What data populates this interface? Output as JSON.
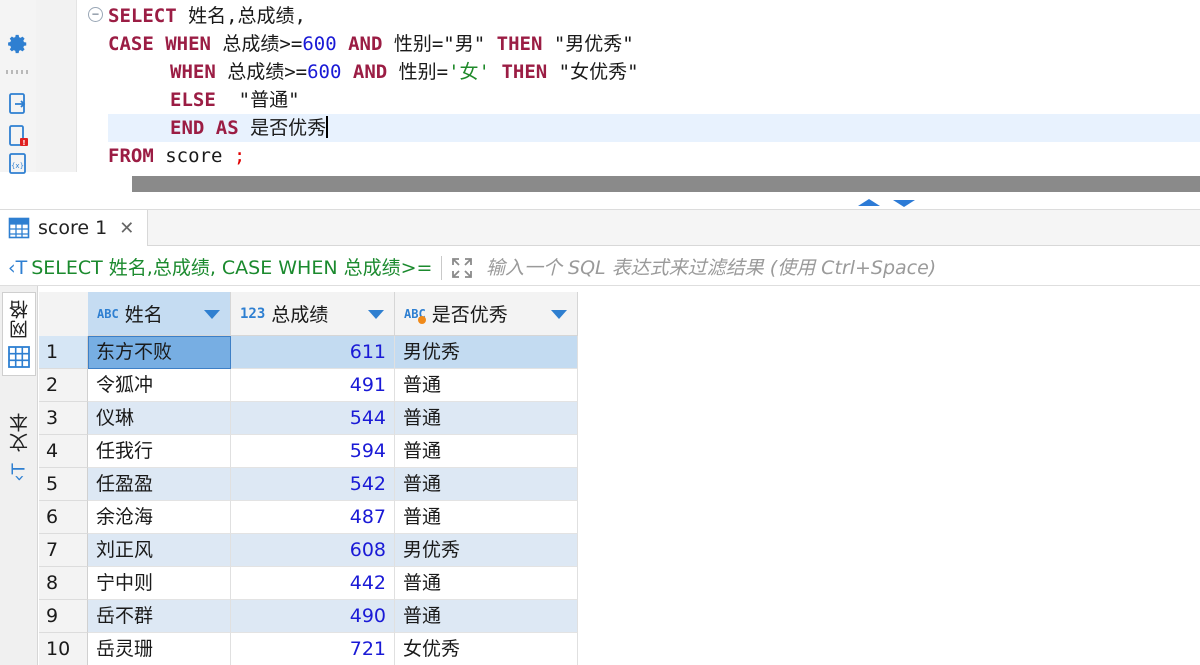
{
  "editor": {
    "lines": [
      {
        "parts": [
          [
            "kw",
            "SELECT"
          ],
          [
            "txt",
            " 姓名,总成绩,"
          ]
        ]
      },
      {
        "parts": [
          [
            "kw",
            "CASE"
          ],
          [
            "txt",
            " "
          ],
          [
            "kw",
            "WHEN"
          ],
          [
            "txt",
            " 总成绩>="
          ],
          [
            "num",
            "600"
          ],
          [
            "txt",
            " "
          ],
          [
            "kw",
            "AND"
          ],
          [
            "txt",
            " 性别=\"男\" "
          ],
          [
            "kw",
            "THEN"
          ],
          [
            "txt",
            " \"男优秀\""
          ]
        ]
      },
      {
        "indent": true,
        "parts": [
          [
            "kw",
            "WHEN"
          ],
          [
            "txt",
            " 总成绩>="
          ],
          [
            "num",
            "600"
          ],
          [
            "txt",
            " "
          ],
          [
            "kw",
            "AND"
          ],
          [
            "txt",
            " 性别="
          ],
          [
            "str-g",
            "'女'"
          ],
          [
            "txt",
            " "
          ],
          [
            "kw",
            "THEN"
          ],
          [
            "txt",
            " \"女优秀\""
          ]
        ]
      },
      {
        "indent": true,
        "parts": [
          [
            "kw",
            "ELSE"
          ],
          [
            "txt",
            "  \"普通\""
          ]
        ]
      },
      {
        "indent": true,
        "current": true,
        "parts": [
          [
            "kw",
            "END"
          ],
          [
            "txt",
            " "
          ],
          [
            "kw",
            "AS"
          ],
          [
            "txt",
            " 是否优秀"
          ]
        ]
      },
      {
        "parts": [
          [
            "kw",
            "FROM"
          ],
          [
            "txt",
            " score "
          ],
          [
            "red",
            ";"
          ]
        ]
      }
    ]
  },
  "result_tab": {
    "label": "score 1",
    "close": "✕"
  },
  "filter": {
    "sql_text": "SELECT 姓名,总成绩, CASE WHEN 总成绩>=",
    "placeholder": "输入一个 SQL 表达式来过滤结果 (使用 Ctrl+Space)"
  },
  "side_tabs": {
    "grid": "网格",
    "text": "文本"
  },
  "grid": {
    "columns": [
      {
        "type": "ABC",
        "label": "姓名"
      },
      {
        "type": "123",
        "label": "总成绩"
      },
      {
        "type": "ABC",
        "label": "是否优秀"
      }
    ],
    "rows": [
      {
        "n": "1",
        "name": "东方不败",
        "score": "611",
        "grade": "男优秀"
      },
      {
        "n": "2",
        "name": "令狐冲",
        "score": "491",
        "grade": "普通"
      },
      {
        "n": "3",
        "name": "仪琳",
        "score": "544",
        "grade": "普通"
      },
      {
        "n": "4",
        "name": "任我行",
        "score": "594",
        "grade": "普通"
      },
      {
        "n": "5",
        "name": "任盈盈",
        "score": "542",
        "grade": "普通"
      },
      {
        "n": "6",
        "name": "余沧海",
        "score": "487",
        "grade": "普通"
      },
      {
        "n": "7",
        "name": "刘正风",
        "score": "608",
        "grade": "男优秀"
      },
      {
        "n": "8",
        "name": "宁中则",
        "score": "442",
        "grade": "普通"
      },
      {
        "n": "9",
        "name": "岳不群",
        "score": "490",
        "grade": "普通"
      },
      {
        "n": "10",
        "name": "岳灵珊",
        "score": "721",
        "grade": "女优秀"
      }
    ]
  },
  "colors": {
    "keyword": "#9b1d44",
    "number": "#1a1ad6",
    "accent": "#2e7fd1",
    "filter_sql": "#1b8a2e",
    "row_alt": "#dde8f4",
    "row_selected": "#c3dbf1"
  }
}
